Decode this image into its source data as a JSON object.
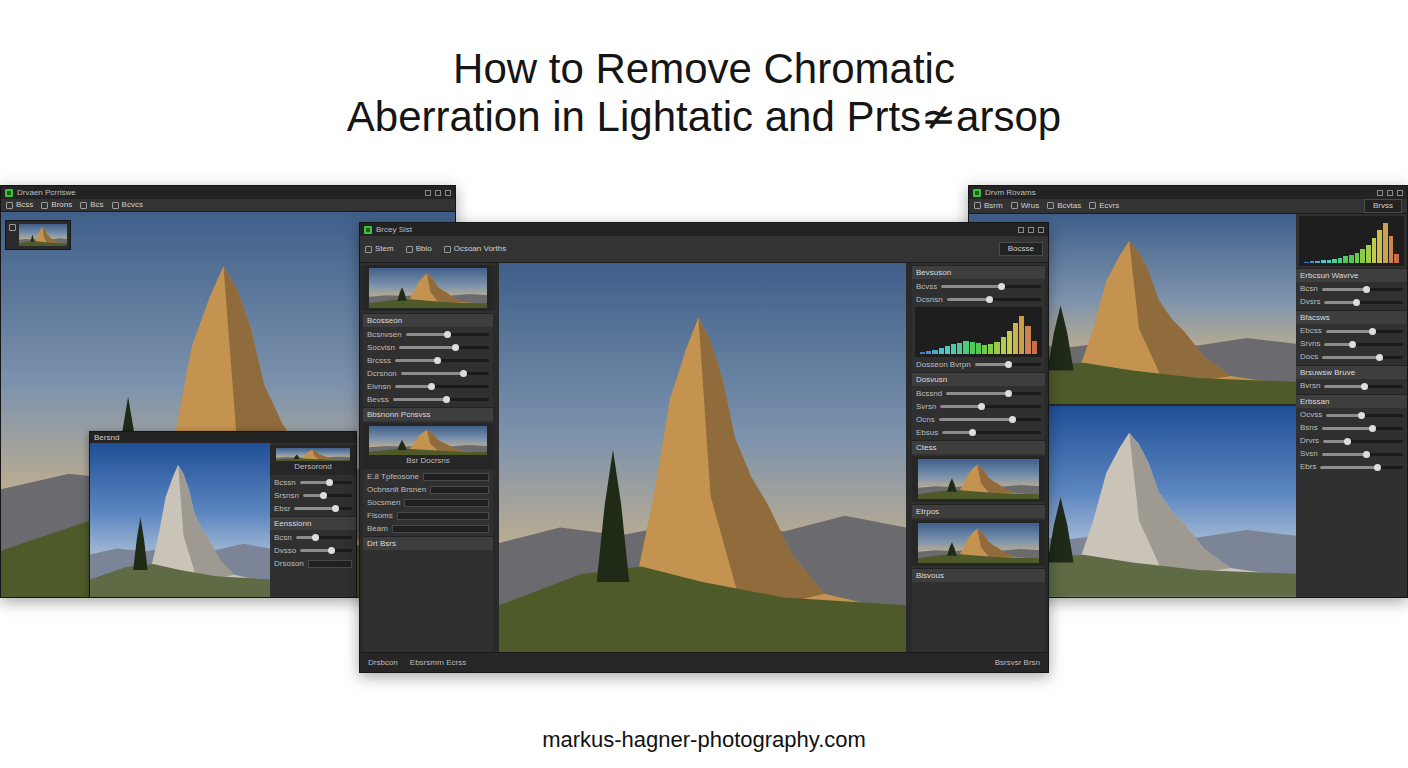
{
  "title": {
    "lines": [
      "How to Remove Chromatic",
      "Aberration in Lightatic and Prts≄arsop"
    ]
  },
  "windows": [
    {
      "title": "Drvaen Pcrriswe",
      "toolbar": [
        "Bcss",
        "Brons",
        "Bcs",
        "Bcvcs"
      ],
      "inset": {
        "title": "Bersnd",
        "panel": [
          {
            "kind": "thumb",
            "label": "Dersorond"
          },
          {
            "kind": "slider",
            "label": "Bcssn",
            "level": 0.55
          },
          {
            "kind": "slider",
            "label": "Srsnsn",
            "level": 0.4
          },
          {
            "kind": "slider",
            "label": "Ebsr",
            "level": 0.7
          },
          {
            "kind": "heading",
            "label": "Eenssionn"
          },
          {
            "kind": "slider",
            "label": "Bcsn",
            "level": 0.35
          },
          {
            "kind": "slider",
            "label": "Dvsso",
            "level": 0.6
          },
          {
            "kind": "field",
            "label": "Drsoson"
          }
        ]
      }
    },
    {
      "title": "Brcey Sist",
      "toolbar": [
        "Stem",
        "Bbio",
        "Ocsoan Vorths"
      ],
      "toolbar_right": "Bocsse",
      "left_panel": [
        {
          "kind": "thumb",
          "label": ""
        },
        {
          "kind": "heading",
          "label": "Bcosseon"
        },
        {
          "kind": "slider",
          "label": "Bcsnvsen",
          "level": 0.5
        },
        {
          "kind": "slider",
          "label": "Socvisn",
          "level": 0.62
        },
        {
          "kind": "slider",
          "label": "Brcsss",
          "level": 0.45
        },
        {
          "kind": "slider",
          "label": "Dcrsnon",
          "level": 0.7
        },
        {
          "kind": "slider",
          "label": "Eivnsn",
          "level": 0.38
        },
        {
          "kind": "slider",
          "label": "Bevss",
          "level": 0.55
        },
        {
          "kind": "heading",
          "label": "Bbsnonn Pcnsvss"
        },
        {
          "kind": "thumb",
          "label": "Bsr Docrsns"
        },
        {
          "kind": "field",
          "label": "E.8 Tpfeosone"
        },
        {
          "kind": "field",
          "label": "Ocbnsnit Brsnen"
        },
        {
          "kind": "field",
          "label": "Socsmen"
        },
        {
          "kind": "field",
          "label": "Flsoms"
        },
        {
          "kind": "field",
          "label": "Beam"
        },
        {
          "kind": "heading",
          "label": "Drt Bsrs"
        }
      ],
      "right_panel": [
        {
          "kind": "heading",
          "label": "Bevsuson"
        },
        {
          "kind": "slider",
          "label": "Bcvss",
          "level": 0.6
        },
        {
          "kind": "slider",
          "label": "Dcsnsn",
          "level": 0.45
        },
        {
          "kind": "histogram",
          "values": [
            4,
            6,
            10,
            14,
            18,
            22,
            26,
            30,
            28,
            24,
            20,
            22,
            28,
            38,
            52,
            70,
            86,
            64,
            30
          ]
        },
        {
          "kind": "slider",
          "label": "Dosseon Bvrpn",
          "level": 0.5
        },
        {
          "kind": "heading",
          "label": "Dosvusn"
        },
        {
          "kind": "slider",
          "label": "Bcssnd",
          "level": 0.65
        },
        {
          "kind": "slider",
          "label": "Svrsn",
          "level": 0.4
        },
        {
          "kind": "slider",
          "label": "Ocns",
          "level": 0.72
        },
        {
          "kind": "slider",
          "label": "Ebsus",
          "level": 0.3
        },
        {
          "kind": "heading",
          "label": "Ctess"
        },
        {
          "kind": "thumb",
          "label": ""
        },
        {
          "kind": "heading",
          "label": "Etrpos"
        },
        {
          "kind": "thumb",
          "label": ""
        },
        {
          "kind": "heading",
          "label": "Bisvous"
        }
      ],
      "status_bar": {
        "left": [
          "Drsbcon",
          "Ebsrsmrn Ecrss"
        ],
        "right": "Bsrsvsr Brsn"
      }
    },
    {
      "title": "Drvm Rovams",
      "toolbar": [
        "Bsrm",
        "Wrus",
        "Bcvtas",
        "Ecvrs"
      ],
      "toolbar_right": "Brvss",
      "right_panel": [
        {
          "kind": "histogram",
          "values": [
            2,
            3,
            4,
            5,
            6,
            8,
            10,
            14,
            18,
            22,
            30,
            40,
            55,
            75,
            90,
            60,
            20
          ]
        },
        {
          "kind": "heading",
          "label": "Erbcsun Wavrve"
        },
        {
          "kind": "slider",
          "label": "Bcsn",
          "level": 0.55
        },
        {
          "kind": "slider",
          "label": "Dvsrs",
          "level": 0.4
        },
        {
          "kind": "heading",
          "label": "Bfacsws"
        },
        {
          "kind": "slider",
          "label": "Ebcss",
          "level": 0.6
        },
        {
          "kind": "slider",
          "label": "Srvns",
          "level": 0.35
        },
        {
          "kind": "slider",
          "label": "Docs",
          "level": 0.7
        },
        {
          "kind": "heading",
          "label": "Brsuwsw Bruve"
        },
        {
          "kind": "slider",
          "label": "Bvrsn",
          "level": 0.5
        },
        {
          "kind": "heading",
          "label": "Erbssan"
        },
        {
          "kind": "slider",
          "label": "Ocvss",
          "level": 0.45
        },
        {
          "kind": "slider",
          "label": "Bsns",
          "level": 0.62
        },
        {
          "kind": "slider",
          "label": "Drvrs",
          "level": 0.3
        },
        {
          "kind": "slider",
          "label": "Svsn",
          "level": 0.55
        },
        {
          "kind": "slider",
          "label": "Ebrs",
          "level": 0.68
        }
      ]
    }
  ],
  "footer": {
    "url": "markus-hagner-photography.com"
  }
}
